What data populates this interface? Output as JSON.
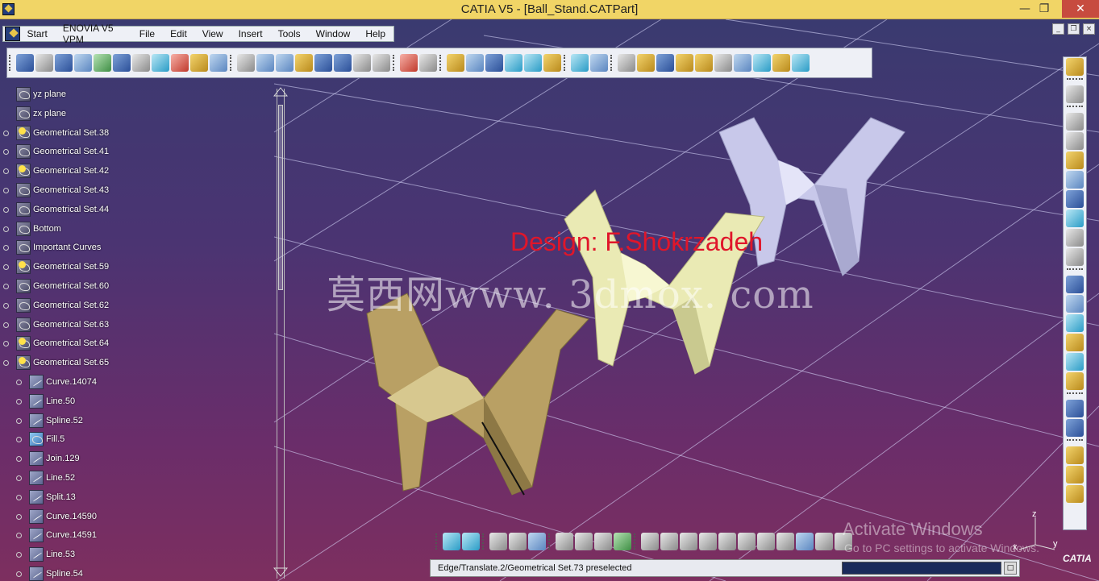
{
  "window": {
    "title": "CATIA V5 - [Ball_Stand.CATPart]",
    "minimize": "—",
    "restore": "❐",
    "close": "✕"
  },
  "menubar": {
    "items": [
      "Start",
      "ENOVIA V5 VPM",
      "File",
      "Edit",
      "View",
      "Insert",
      "Tools",
      "Window",
      "Help"
    ]
  },
  "tree": {
    "nodes": [
      {
        "label": "yz plane",
        "level": 0,
        "icon": "plane-icon"
      },
      {
        "label": "zx plane",
        "level": 0,
        "icon": "plane-icon"
      },
      {
        "label": "Geometrical Set.38",
        "level": 0,
        "icon": "geometrical-set-icon",
        "active": true
      },
      {
        "label": "Geometrical Set.41",
        "level": 0,
        "icon": "geometrical-set-icon"
      },
      {
        "label": "Geometrical Set.42",
        "level": 0,
        "icon": "geometrical-set-icon",
        "active": true
      },
      {
        "label": "Geometrical Set.43",
        "level": 0,
        "icon": "geometrical-set-icon"
      },
      {
        "label": "Geometrical Set.44",
        "level": 0,
        "icon": "geometrical-set-icon"
      },
      {
        "label": "Bottom",
        "level": 0,
        "icon": "geometrical-set-icon"
      },
      {
        "label": "Important Curves",
        "level": 0,
        "icon": "geometrical-set-icon"
      },
      {
        "label": "Geometrical Set.59",
        "level": 0,
        "icon": "geometrical-set-icon",
        "active": true
      },
      {
        "label": "Geometrical Set.60",
        "level": 0,
        "icon": "geometrical-set-icon"
      },
      {
        "label": "Geometrical Set.62",
        "level": 0,
        "icon": "geometrical-set-icon"
      },
      {
        "label": "Geometrical Set.63",
        "level": 0,
        "icon": "geometrical-set-icon"
      },
      {
        "label": "Geometrical Set.64",
        "level": 0,
        "icon": "geometrical-set-icon",
        "active": true
      },
      {
        "label": "Geometrical Set.65",
        "level": 0,
        "icon": "geometrical-set-icon",
        "active": true
      },
      {
        "label": "Curve.14074",
        "level": 1,
        "icon": "curve-icon"
      },
      {
        "label": "Line.50",
        "level": 1,
        "icon": "line-icon"
      },
      {
        "label": "Spline.52",
        "level": 1,
        "icon": "spline-icon"
      },
      {
        "label": "Fill.5",
        "level": 1,
        "icon": "fill-icon"
      },
      {
        "label": "Join.129",
        "level": 1,
        "icon": "join-icon"
      },
      {
        "label": "Line.52",
        "level": 1,
        "icon": "line-icon"
      },
      {
        "label": "Split.13",
        "level": 1,
        "icon": "split-icon"
      },
      {
        "label": "Curve.14590",
        "level": 1,
        "icon": "curve-icon"
      },
      {
        "label": "Curve.14591",
        "level": 1,
        "icon": "curve-icon"
      },
      {
        "label": "Line.53",
        "level": 1,
        "icon": "line-icon"
      },
      {
        "label": "Spline.54",
        "level": 1,
        "icon": "spline-icon"
      }
    ]
  },
  "overlays": {
    "design_credit": "Design: F.Shokrzadeh",
    "watermark": "莫西网www. 3dmox. com",
    "activate_title": "Activate Windows",
    "activate_sub": "Go to PC settings to activate Windows."
  },
  "status": {
    "message": "Edge/Translate.2/Geometrical Set.73 preselected",
    "command_value": ""
  },
  "axes": {
    "z": "z",
    "x": "x",
    "y": "y"
  },
  "logo": "CATIA",
  "colors": {
    "title_bar": "#f1d566",
    "design_credit": "#e0162a",
    "part_near": "#b9a064",
    "part_mid": "#eaeab4",
    "part_far": "#c8c8ea"
  }
}
